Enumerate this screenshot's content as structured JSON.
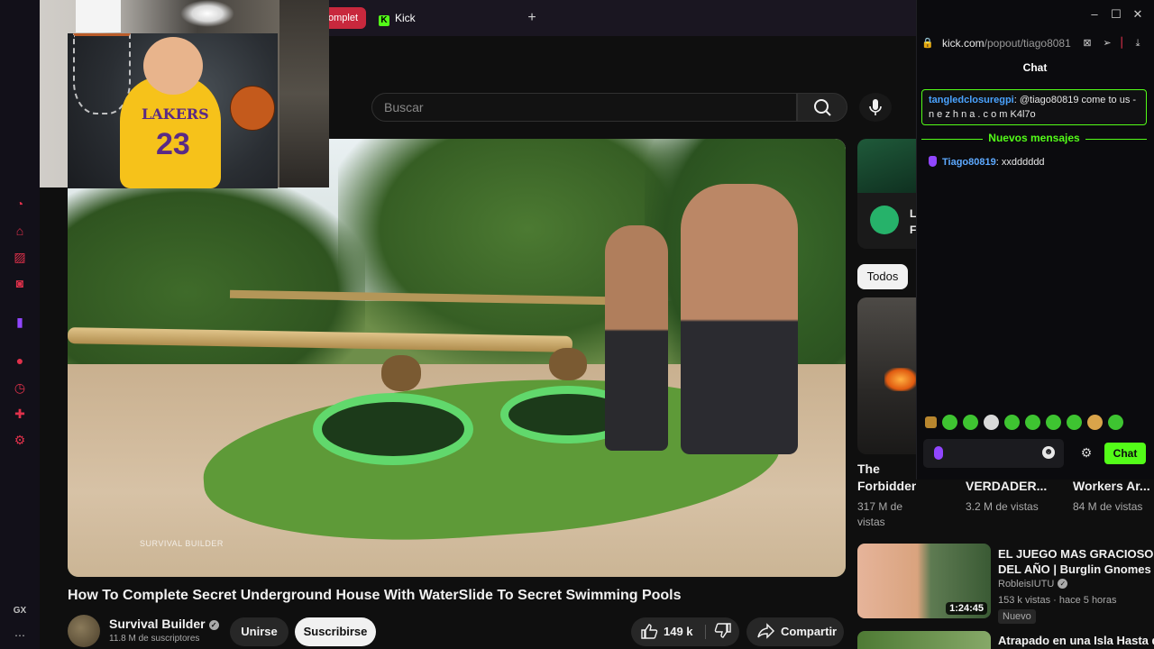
{
  "browser": {
    "tabs": [
      {
        "label": "omplet",
        "active": true
      },
      {
        "label": "Kick",
        "active": false
      }
    ],
    "new_tab_symbol": "+",
    "gx_label": "GX",
    "more_symbol": "⋯"
  },
  "youtube": {
    "search": {
      "placeholder": "Buscar"
    },
    "video": {
      "title": "How To Complete Secret Underground House With WaterSlide To Secret Swimming Pools",
      "watermark": "SURVIVAL BUILDER"
    },
    "channel": {
      "name": "Survival Builder",
      "subscribers": "11.8 M de suscriptores"
    },
    "buttons": {
      "join": "Unirse",
      "subscribe": "Suscribirse",
      "likes": "149 k",
      "share": "Compartir"
    },
    "sidebar": {
      "ad_letters": [
        "L",
        "F"
      ],
      "chip": "Todos",
      "shorts": [
        {
          "title": "The",
          "title2": "Forbidden ...",
          "views": "317 M de",
          "views2": "vistas"
        },
        {
          "title": "VERDADER...",
          "views": "3.2 M de vistas"
        },
        {
          "title": "Workers Ar...",
          "views": "84 M de vistas"
        }
      ],
      "recommended": [
        {
          "title": "EL JUEGO MAS GRACIOSO DEL AÑO | Burglin Gnomes",
          "channel": "RobleisIUTU",
          "meta": "153 k vistas · hace 5 horas",
          "duration": "1:24:45",
          "badge": "Nuevo"
        },
        {
          "title": "Atrapado en una Isla Hasta que"
        }
      ]
    }
  },
  "overlay": {
    "jersey_text": "LAKERS",
    "jersey_number": "23"
  },
  "kick_chat": {
    "url_host": "kick.com",
    "url_path": "/popout/tiago8081",
    "header": "Chat",
    "pinned": {
      "user": "tangledclosuregpi",
      "text": ": @tiago80819 come to us - n e z h n a . c o m K4l7o"
    },
    "new_messages_label": "Nuevos mensajes",
    "messages": [
      {
        "user": "Tiago80819",
        "text": ": xxdddddd"
      }
    ],
    "send_label": "Chat"
  },
  "window_controls": [
    "–",
    "☐",
    "✕"
  ]
}
